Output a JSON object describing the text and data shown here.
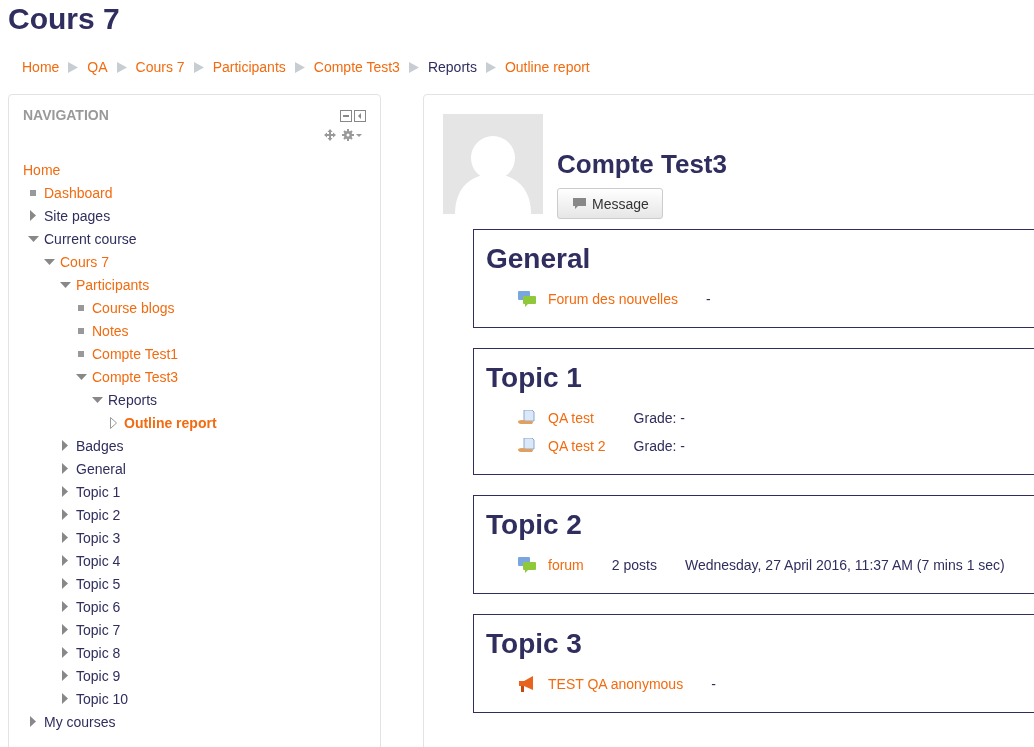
{
  "page_title": "Cours 7",
  "breadcrumb": [
    {
      "label": "Home",
      "link": true
    },
    {
      "label": "QA",
      "link": true
    },
    {
      "label": "Cours 7",
      "link": true
    },
    {
      "label": "Participants",
      "link": true
    },
    {
      "label": "Compte Test3",
      "link": true
    },
    {
      "label": "Reports",
      "link": false
    },
    {
      "label": "Outline report",
      "link": true
    }
  ],
  "navigation": {
    "title": "NAVIGATION",
    "items": [
      {
        "label": "Home",
        "kind": "plain",
        "link": true
      },
      {
        "label": "Dashboard",
        "kind": "leaf",
        "link": true
      },
      {
        "label": "Site pages",
        "kind": "branch",
        "link": false,
        "expanded": false
      },
      {
        "label": "Current course",
        "kind": "branch",
        "link": false,
        "expanded": true,
        "children": [
          {
            "label": "Cours 7",
            "kind": "branch",
            "link": true,
            "expanded": true,
            "children": [
              {
                "label": "Participants",
                "kind": "branch",
                "link": true,
                "expanded": true,
                "children": [
                  {
                    "label": "Course blogs",
                    "kind": "leaf",
                    "link": true
                  },
                  {
                    "label": "Notes",
                    "kind": "leaf",
                    "link": true
                  },
                  {
                    "label": "Compte Test1",
                    "kind": "leaf",
                    "link": true
                  },
                  {
                    "label": "Compte Test3",
                    "kind": "branch",
                    "link": true,
                    "expanded": true,
                    "children": [
                      {
                        "label": "Reports",
                        "kind": "branch",
                        "link": false,
                        "expanded": true,
                        "children": [
                          {
                            "label": "Outline report",
                            "kind": "current",
                            "link": true
                          }
                        ]
                      }
                    ]
                  }
                ]
              },
              {
                "label": "Badges",
                "kind": "branch",
                "link": false,
                "expanded": false
              },
              {
                "label": "General",
                "kind": "branch",
                "link": false,
                "expanded": false
              },
              {
                "label": "Topic 1",
                "kind": "branch",
                "link": false,
                "expanded": false
              },
              {
                "label": "Topic 2",
                "kind": "branch",
                "link": false,
                "expanded": false
              },
              {
                "label": "Topic 3",
                "kind": "branch",
                "link": false,
                "expanded": false
              },
              {
                "label": "Topic 4",
                "kind": "branch",
                "link": false,
                "expanded": false
              },
              {
                "label": "Topic 5",
                "kind": "branch",
                "link": false,
                "expanded": false
              },
              {
                "label": "Topic 6",
                "kind": "branch",
                "link": false,
                "expanded": false
              },
              {
                "label": "Topic 7",
                "kind": "branch",
                "link": false,
                "expanded": false
              },
              {
                "label": "Topic 8",
                "kind": "branch",
                "link": false,
                "expanded": false
              },
              {
                "label": "Topic 9",
                "kind": "branch",
                "link": false,
                "expanded": false
              },
              {
                "label": "Topic 10",
                "kind": "branch",
                "link": false,
                "expanded": false
              }
            ]
          }
        ]
      },
      {
        "label": "My courses",
        "kind": "branch",
        "link": false,
        "expanded": false
      }
    ]
  },
  "user": {
    "name": "Compte Test3",
    "message_button": "Message"
  },
  "sections": [
    {
      "title": "General",
      "activities": [
        {
          "kind": "forum",
          "name": "Forum des nouvelles",
          "details": [
            "-"
          ]
        }
      ]
    },
    {
      "title": "Topic 1",
      "activities": [
        {
          "kind": "quiz",
          "name": "QA test",
          "details": [
            "Grade: -"
          ]
        },
        {
          "kind": "quiz",
          "name": "QA test 2",
          "details": [
            "Grade: -"
          ]
        }
      ]
    },
    {
      "title": "Topic 2",
      "activities": [
        {
          "kind": "forum",
          "name": "forum",
          "details": [
            "2 posts",
            "Wednesday, 27 April 2016, 11:37 AM (7 mins 1 sec)"
          ]
        }
      ]
    },
    {
      "title": "Topic 3",
      "activities": [
        {
          "kind": "feedback",
          "name": "TEST QA anonymous",
          "details": [
            "-"
          ]
        }
      ]
    }
  ]
}
